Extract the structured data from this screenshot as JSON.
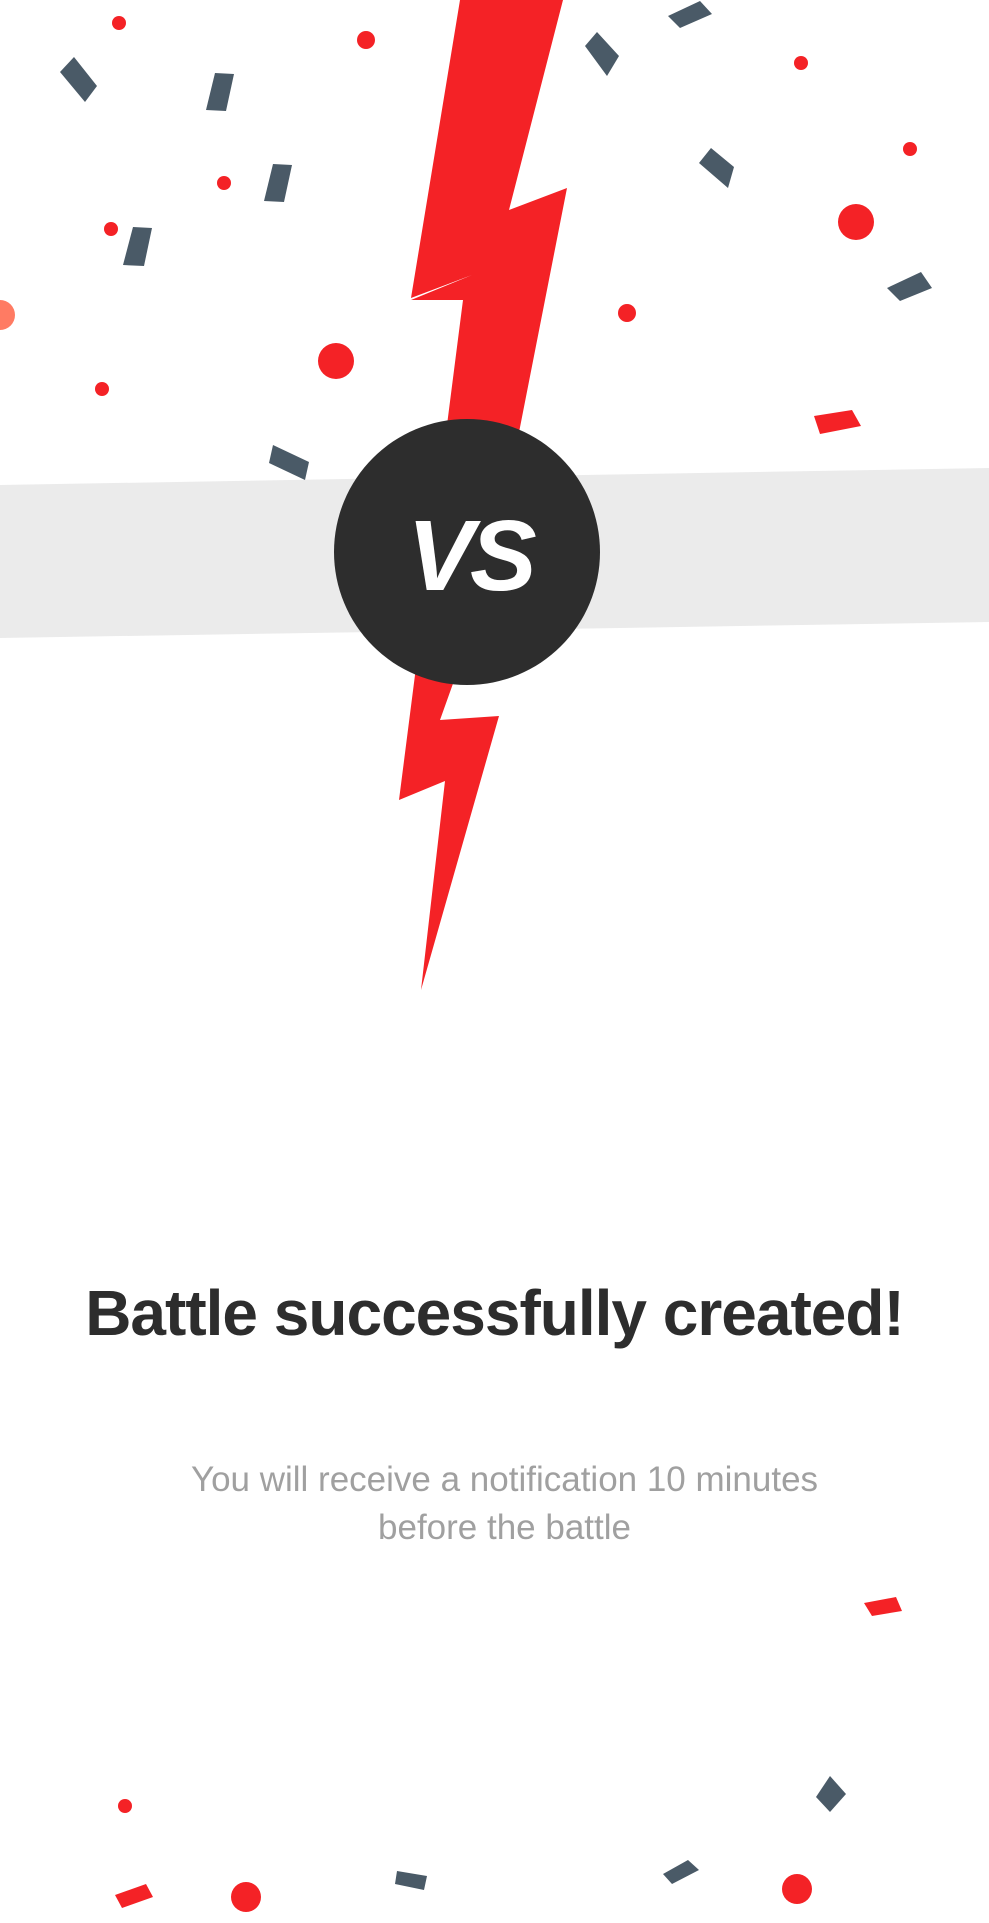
{
  "badge": {
    "text": "VS"
  },
  "message": {
    "title": "Battle successfully created!",
    "subtitle": "You will receive a notification 10 minutes before the battle"
  },
  "colors": {
    "accent_red": "#F42226",
    "dark": "#2D2D2D",
    "slate_confetti": "#4A5A67",
    "band_grey": "#EBEBEB",
    "coral": "#FF7B63",
    "subtitle_grey": "#A0A0A0",
    "badge_text": "#FFFFFF"
  },
  "icons": [
    "lightning-bolt-icon",
    "confetti"
  ]
}
